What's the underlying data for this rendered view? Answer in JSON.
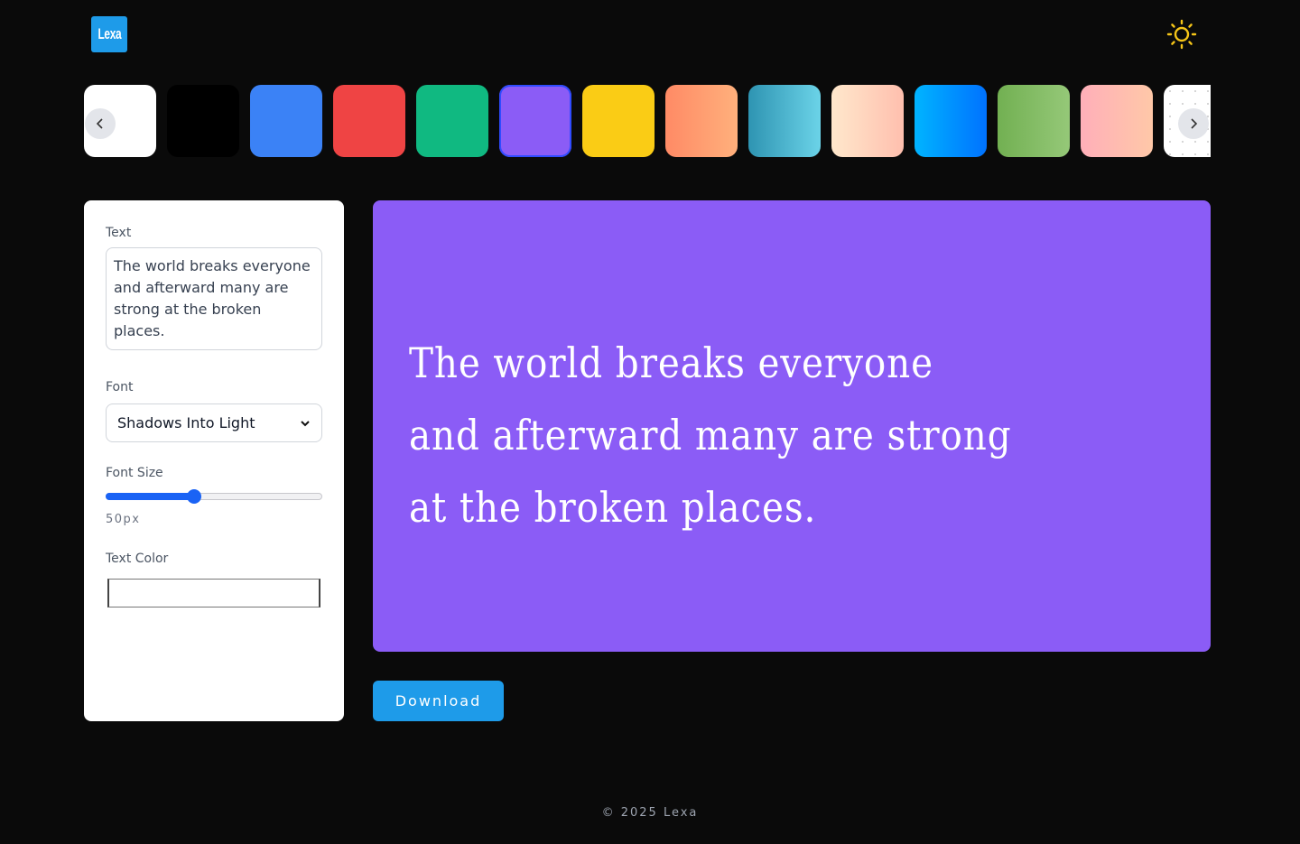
{
  "header": {
    "logo_text": "Lexa",
    "logo_color": "#1e9be9",
    "theme_icon": "sun-icon",
    "theme_icon_color": "#f5c518"
  },
  "swatches": [
    {
      "name": "white",
      "bg": "#ffffff"
    },
    {
      "name": "black",
      "bg": "#000000"
    },
    {
      "name": "blue",
      "bg": "#3b82f6"
    },
    {
      "name": "red",
      "bg": "#ef4444"
    },
    {
      "name": "green",
      "bg": "#10b981"
    },
    {
      "name": "purple",
      "bg": "#8b5cf6",
      "selected": true
    },
    {
      "name": "yellow",
      "bg": "#facc15"
    },
    {
      "name": "orange-gradient",
      "bg": "linear-gradient(90deg,#ff8a65,#ffb07c)"
    },
    {
      "name": "teal-gradient",
      "bg": "linear-gradient(90deg,#2e94b2,#6bd3e8)"
    },
    {
      "name": "peach-gradient",
      "bg": "linear-gradient(90deg,#ffe8cc,#ffbfae)"
    },
    {
      "name": "sky-gradient",
      "bg": "linear-gradient(90deg,#00b4ff,#0072ff)"
    },
    {
      "name": "lime-gradient",
      "bg": "linear-gradient(90deg,#72b052,#95c878)"
    },
    {
      "name": "pink-gradient",
      "bg": "linear-gradient(90deg,#ffafb9,#ffc8a8)"
    },
    {
      "name": "dotted-white",
      "bg": "radial-gradient(#c9c9c9 1px, #ffffff 1px)"
    }
  ],
  "swatch_nav": {
    "prev_icon": "chevron-left-icon",
    "next_icon": "chevron-right-icon"
  },
  "controls": {
    "text_label": "Text",
    "text_value": "The world breaks everyone and afterward many are strong at the broken places.",
    "font_label": "Font",
    "font_value": "Shadows Into Light",
    "font_size_label": "Font Size",
    "font_size_value": "50px",
    "font_size_fraction": 0.41,
    "text_color_label": "Text Color",
    "text_color_value": "#ffffff"
  },
  "preview": {
    "text": "The world breaks everyone and afterward many are strong at the broken places.",
    "bg_color": "#8b5cf6",
    "text_color": "#ffffff"
  },
  "download_label": "Download",
  "footer": "© 2025 Lexa"
}
